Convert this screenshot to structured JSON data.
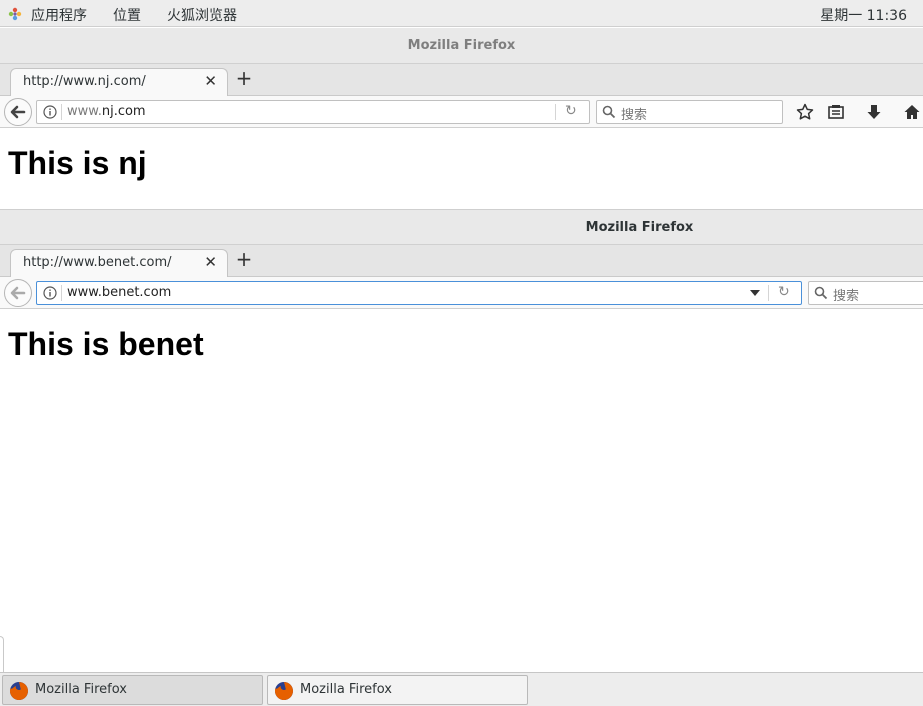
{
  "topbar": {
    "menus": [
      "应用程序",
      "位置",
      "火狐浏览器"
    ],
    "clock": "星期一 11:36"
  },
  "windows": [
    {
      "title": "Mozilla Firefox",
      "tab_title": "http://www.nj.com/",
      "url_prefix": "www.",
      "url_domain": "nj.com",
      "search_placeholder": "搜索",
      "heading": "This is nj"
    },
    {
      "title": "Mozilla Firefox",
      "tab_title": "http://www.benet.com/",
      "url": "www.benet.com",
      "search_placeholder": "搜索",
      "heading": "This is benet"
    }
  ],
  "taskbar": {
    "items": [
      "Mozilla Firefox",
      "Mozilla Firefox"
    ]
  },
  "colors": {
    "accent_focus": "#4a90d9",
    "firefox_orange": "#e66000",
    "firefox_blue": "#2a3f8f"
  }
}
